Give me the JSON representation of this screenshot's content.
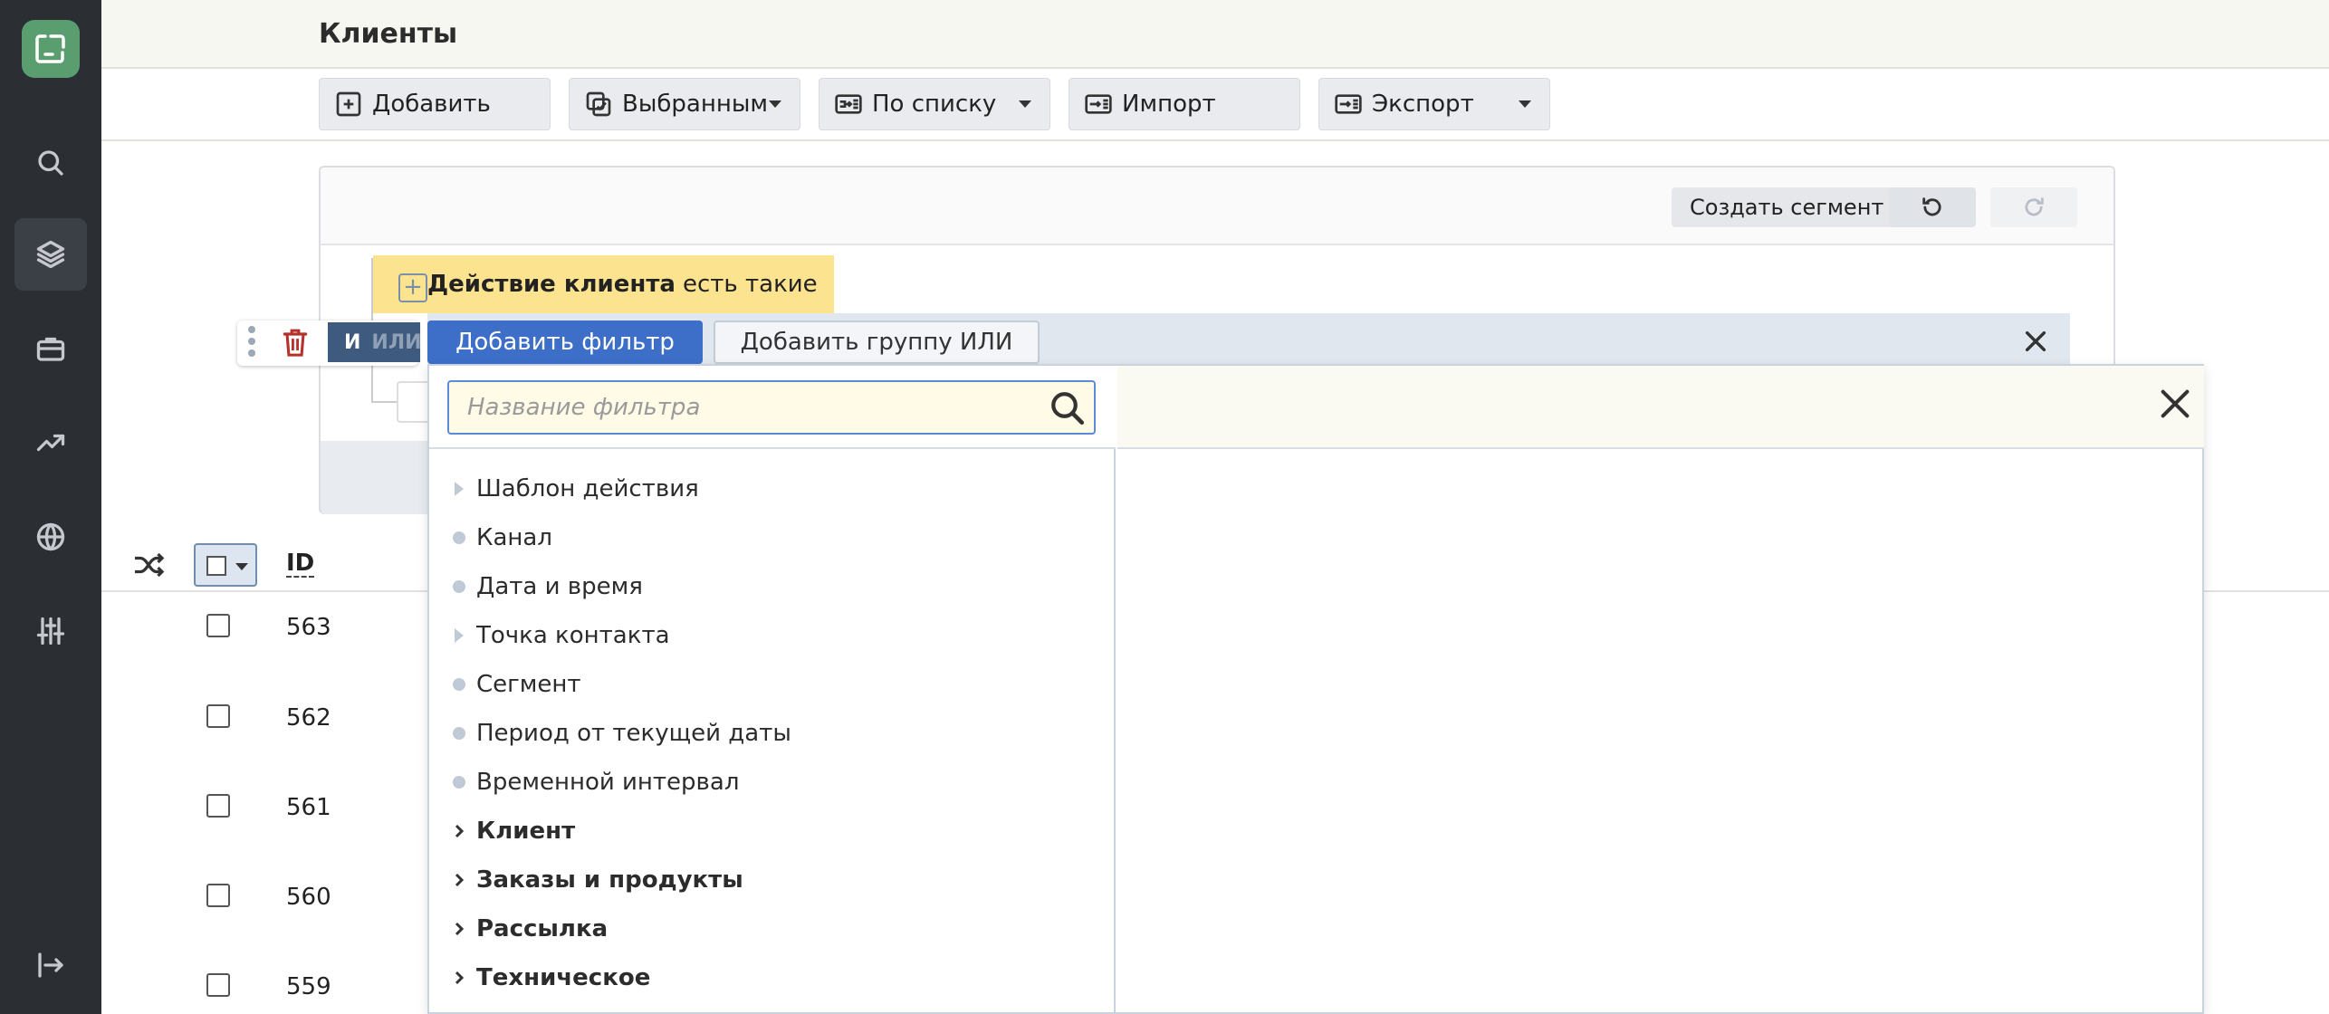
{
  "header": {
    "title": "Клиенты"
  },
  "sidebar": {
    "items": [
      "search-icon",
      "layers-icon",
      "briefcase-icon",
      "trending-icon",
      "globe-icon",
      "sliders-icon",
      "logout-icon"
    ]
  },
  "toolbar": {
    "add_label": "Добавить",
    "selected_label": "Выбранным",
    "by_list_label": "По списку",
    "import_label": "Импорт",
    "export_label": "Экспорт"
  },
  "filter_panel": {
    "create_segment_label": "Создать сегмент",
    "action_chip": {
      "bold": "Действие клиента",
      "rest": "есть такие"
    },
    "and_label": "И",
    "or_label": "ИЛИ",
    "add_filter_label": "Добавить фильтр",
    "add_or_group_label": "Добавить группу ИЛИ"
  },
  "popup": {
    "search_placeholder": "Название фильтра",
    "items": [
      {
        "label": "Шаблон действия",
        "kind": "triangle"
      },
      {
        "label": "Канал",
        "kind": "dot"
      },
      {
        "label": "Дата и время",
        "kind": "dot"
      },
      {
        "label": "Точка контакта",
        "kind": "triangle"
      },
      {
        "label": "Сегмент",
        "kind": "dot"
      },
      {
        "label": "Период от текущей даты",
        "kind": "dot"
      },
      {
        "label": "Временной интервал",
        "kind": "dot"
      },
      {
        "label": "Клиент",
        "kind": "group"
      },
      {
        "label": "Заказы и продукты",
        "kind": "group"
      },
      {
        "label": "Рассылка",
        "kind": "group"
      },
      {
        "label": "Техническое",
        "kind": "group"
      }
    ]
  },
  "table": {
    "id_header": "ID",
    "rows": [
      "563",
      "562",
      "561",
      "560",
      "559"
    ]
  },
  "colors": {
    "sidebar_bg": "#2b2e33",
    "logo_green": "#5a9e6f",
    "accent_blue": "#3d6fc8",
    "action_yellow": "#fbe38f",
    "delete_red": "#b5312b"
  }
}
